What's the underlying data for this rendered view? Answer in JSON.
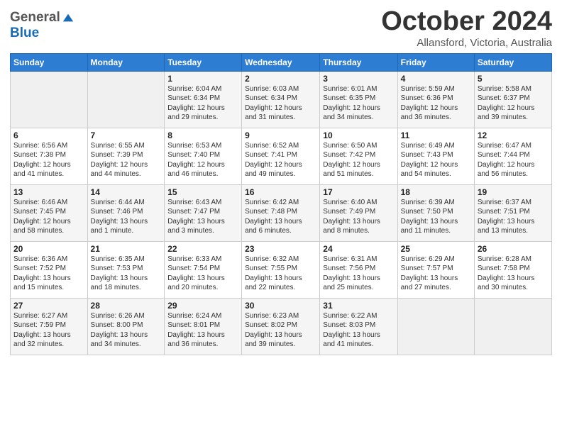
{
  "header": {
    "logo_general": "General",
    "logo_blue": "Blue",
    "month_title": "October 2024",
    "location": "Allansford, Victoria, Australia"
  },
  "days_of_week": [
    "Sunday",
    "Monday",
    "Tuesday",
    "Wednesday",
    "Thursday",
    "Friday",
    "Saturday"
  ],
  "weeks": [
    [
      {
        "day": "",
        "info": ""
      },
      {
        "day": "",
        "info": ""
      },
      {
        "day": "1",
        "info": "Sunrise: 6:04 AM\nSunset: 6:34 PM\nDaylight: 12 hours\nand 29 minutes."
      },
      {
        "day": "2",
        "info": "Sunrise: 6:03 AM\nSunset: 6:34 PM\nDaylight: 12 hours\nand 31 minutes."
      },
      {
        "day": "3",
        "info": "Sunrise: 6:01 AM\nSunset: 6:35 PM\nDaylight: 12 hours\nand 34 minutes."
      },
      {
        "day": "4",
        "info": "Sunrise: 5:59 AM\nSunset: 6:36 PM\nDaylight: 12 hours\nand 36 minutes."
      },
      {
        "day": "5",
        "info": "Sunrise: 5:58 AM\nSunset: 6:37 PM\nDaylight: 12 hours\nand 39 minutes."
      }
    ],
    [
      {
        "day": "6",
        "info": "Sunrise: 6:56 AM\nSunset: 7:38 PM\nDaylight: 12 hours\nand 41 minutes."
      },
      {
        "day": "7",
        "info": "Sunrise: 6:55 AM\nSunset: 7:39 PM\nDaylight: 12 hours\nand 44 minutes."
      },
      {
        "day": "8",
        "info": "Sunrise: 6:53 AM\nSunset: 7:40 PM\nDaylight: 12 hours\nand 46 minutes."
      },
      {
        "day": "9",
        "info": "Sunrise: 6:52 AM\nSunset: 7:41 PM\nDaylight: 12 hours\nand 49 minutes."
      },
      {
        "day": "10",
        "info": "Sunrise: 6:50 AM\nSunset: 7:42 PM\nDaylight: 12 hours\nand 51 minutes."
      },
      {
        "day": "11",
        "info": "Sunrise: 6:49 AM\nSunset: 7:43 PM\nDaylight: 12 hours\nand 54 minutes."
      },
      {
        "day": "12",
        "info": "Sunrise: 6:47 AM\nSunset: 7:44 PM\nDaylight: 12 hours\nand 56 minutes."
      }
    ],
    [
      {
        "day": "13",
        "info": "Sunrise: 6:46 AM\nSunset: 7:45 PM\nDaylight: 12 hours\nand 58 minutes."
      },
      {
        "day": "14",
        "info": "Sunrise: 6:44 AM\nSunset: 7:46 PM\nDaylight: 13 hours\nand 1 minute."
      },
      {
        "day": "15",
        "info": "Sunrise: 6:43 AM\nSunset: 7:47 PM\nDaylight: 13 hours\nand 3 minutes."
      },
      {
        "day": "16",
        "info": "Sunrise: 6:42 AM\nSunset: 7:48 PM\nDaylight: 13 hours\nand 6 minutes."
      },
      {
        "day": "17",
        "info": "Sunrise: 6:40 AM\nSunset: 7:49 PM\nDaylight: 13 hours\nand 8 minutes."
      },
      {
        "day": "18",
        "info": "Sunrise: 6:39 AM\nSunset: 7:50 PM\nDaylight: 13 hours\nand 11 minutes."
      },
      {
        "day": "19",
        "info": "Sunrise: 6:37 AM\nSunset: 7:51 PM\nDaylight: 13 hours\nand 13 minutes."
      }
    ],
    [
      {
        "day": "20",
        "info": "Sunrise: 6:36 AM\nSunset: 7:52 PM\nDaylight: 13 hours\nand 15 minutes."
      },
      {
        "day": "21",
        "info": "Sunrise: 6:35 AM\nSunset: 7:53 PM\nDaylight: 13 hours\nand 18 minutes."
      },
      {
        "day": "22",
        "info": "Sunrise: 6:33 AM\nSunset: 7:54 PM\nDaylight: 13 hours\nand 20 minutes."
      },
      {
        "day": "23",
        "info": "Sunrise: 6:32 AM\nSunset: 7:55 PM\nDaylight: 13 hours\nand 22 minutes."
      },
      {
        "day": "24",
        "info": "Sunrise: 6:31 AM\nSunset: 7:56 PM\nDaylight: 13 hours\nand 25 minutes."
      },
      {
        "day": "25",
        "info": "Sunrise: 6:29 AM\nSunset: 7:57 PM\nDaylight: 13 hours\nand 27 minutes."
      },
      {
        "day": "26",
        "info": "Sunrise: 6:28 AM\nSunset: 7:58 PM\nDaylight: 13 hours\nand 30 minutes."
      }
    ],
    [
      {
        "day": "27",
        "info": "Sunrise: 6:27 AM\nSunset: 7:59 PM\nDaylight: 13 hours\nand 32 minutes."
      },
      {
        "day": "28",
        "info": "Sunrise: 6:26 AM\nSunset: 8:00 PM\nDaylight: 13 hours\nand 34 minutes."
      },
      {
        "day": "29",
        "info": "Sunrise: 6:24 AM\nSunset: 8:01 PM\nDaylight: 13 hours\nand 36 minutes."
      },
      {
        "day": "30",
        "info": "Sunrise: 6:23 AM\nSunset: 8:02 PM\nDaylight: 13 hours\nand 39 minutes."
      },
      {
        "day": "31",
        "info": "Sunrise: 6:22 AM\nSunset: 8:03 PM\nDaylight: 13 hours\nand 41 minutes."
      },
      {
        "day": "",
        "info": ""
      },
      {
        "day": "",
        "info": ""
      }
    ]
  ]
}
